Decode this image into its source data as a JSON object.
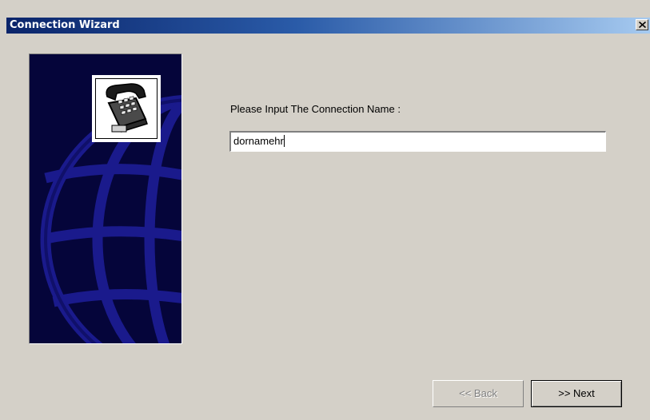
{
  "window": {
    "title": "Connection Wizard",
    "close_glyph": "✕",
    "close_icon": "close-icon"
  },
  "banner": {
    "icon": "telephone-icon",
    "background_icon": "globe-icon"
  },
  "form": {
    "prompt": "Please Input The Connection Name :",
    "connection_name_value": "dornamehr"
  },
  "buttons": {
    "back_label": "<< Back",
    "back_enabled": false,
    "next_label": ">> Next",
    "next_enabled": true
  },
  "colors": {
    "title_gradient_start": "#0a246a",
    "title_gradient_end": "#a6caf0",
    "dialog_face": "#d4d0c8",
    "banner_background": "#05053a",
    "globe_lines": "#1a1a8c"
  }
}
